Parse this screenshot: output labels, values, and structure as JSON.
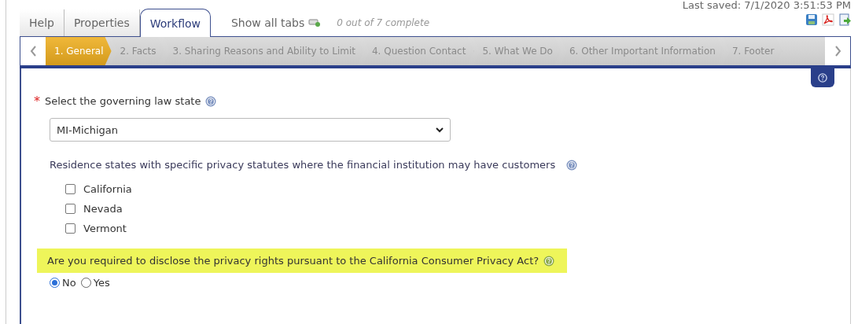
{
  "tabs": [
    {
      "label": "Help",
      "selected": false
    },
    {
      "label": "Properties",
      "selected": false
    },
    {
      "label": "Workflow",
      "selected": true
    }
  ],
  "show_all_tabs": "Show all tabs",
  "progress": "0 out of 7 complete",
  "last_saved": "Last saved: 7/1/2020 3:51:53 PM",
  "steps": [
    {
      "label": "1. General",
      "selected": true
    },
    {
      "label": "2. Facts",
      "selected": false
    },
    {
      "label": "3. Sharing Reasons and Ability to Limit",
      "selected": false
    },
    {
      "label": "4. Question Contact",
      "selected": false
    },
    {
      "label": "5. What We Do",
      "selected": false
    },
    {
      "label": "6. Other Important Information",
      "selected": false
    },
    {
      "label": "7. Footer",
      "selected": false
    }
  ],
  "governing_law": {
    "required_mark": "*",
    "label": "Select the governing law state",
    "value": "MI-Michigan"
  },
  "residence": {
    "label": "Residence states with specific privacy statutes where the financial institution may have customers",
    "options": [
      {
        "label": "California",
        "checked": false
      },
      {
        "label": "Nevada",
        "checked": false
      },
      {
        "label": "Vermont",
        "checked": false
      }
    ]
  },
  "ccpa": {
    "question": "Are you required to disclose the privacy rights pursuant to the California Consumer Privacy Act?",
    "highlighted": true,
    "options": [
      {
        "label": "No",
        "selected": true
      },
      {
        "label": "Yes",
        "selected": false
      }
    ]
  }
}
